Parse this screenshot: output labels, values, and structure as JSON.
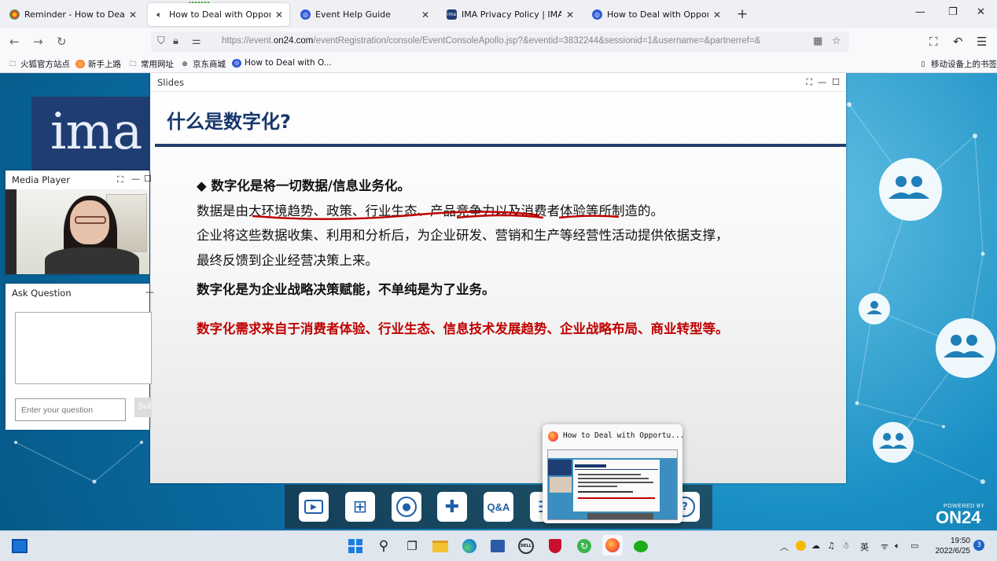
{
  "browser": {
    "tabs": [
      {
        "title": "Reminder - How to Deal with",
        "favicon": "chrome-reminder-icon"
      },
      {
        "title": "How to Deal with Opportunit",
        "favicon": "speaker-icon"
      },
      {
        "title": "Event Help Guide",
        "favicon": "on24-icon"
      },
      {
        "title": "IMA Privacy Policy | IMA - Th",
        "favicon": "ima-icon"
      },
      {
        "title": "How to Deal with Opportunit",
        "favicon": "on24-icon"
      }
    ],
    "url_prefix": "https://event.",
    "url_domain": "on24.com",
    "url_rest": "/eventRegistration/console/EventConsoleApollo.jsp?&eventid=3832244&sessionid=1&username=&partnerref=&",
    "bookmarks": [
      {
        "label": "火狐官方站点"
      },
      {
        "label": "新手上路"
      },
      {
        "label": "常用网址"
      },
      {
        "label": "京东商城"
      },
      {
        "label": "How to Deal with O..."
      }
    ],
    "mobile_bookmarks": "移动设备上的书签"
  },
  "slides": {
    "header": "Slides",
    "title": "什么是数字化?",
    "line1": "◆  数字化是将一切数据/信息业务化。",
    "line2": "数据是由大环境趋势、政策、行业生态、产品竞争力以及消费者体验等所制造的。",
    "line3": "企业将这些数据收集、利用和分析后，为企业研发、营销和生产等经营性活动提供依据支撑，",
    "line4": "最终反馈到企业经营决策上来。",
    "line5": "数字化是为企业战略决策赋能，不单纯是为了业务。",
    "line6": "数字化需求来自于消费者体验、行业生态、信息技术发展趋势、企业战略布局、商业转型等。"
  },
  "media_player": {
    "header": "Media Player"
  },
  "ask_question": {
    "header": "Ask Question",
    "placeholder": "Enter your question",
    "submit": "Submit"
  },
  "logo": {
    "text": "ima"
  },
  "dock": {
    "qa_label": "Q&A"
  },
  "powered": {
    "small": "POWERED BY",
    "brand": "ON24"
  },
  "preview": {
    "title": "How to Deal with Opportu..."
  },
  "taskbar": {
    "ime": "英",
    "time": "19:50",
    "date": "2022/6/25",
    "notifications": "3"
  },
  "colors": {
    "slide_title": "#17376b",
    "red_text": "#c00000",
    "rule": "#233f6e",
    "underline": "#c00000"
  }
}
